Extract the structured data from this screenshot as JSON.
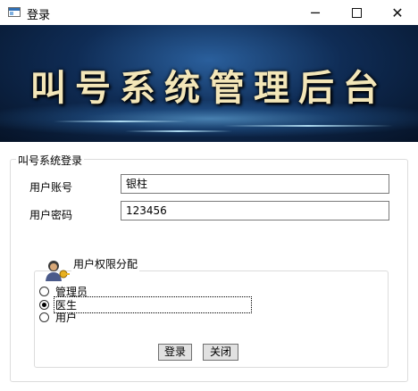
{
  "window": {
    "title": "登录",
    "minimize_glyph": "─",
    "close_glyph": "✕"
  },
  "banner": {
    "title": "叫号系统管理后台"
  },
  "login_group": {
    "legend": "叫号系统登录",
    "account_label": "用户账号",
    "account_value": "银柱",
    "password_label": "用户密码",
    "password_value": "123456"
  },
  "permission_group": {
    "legend": "用户权限分配",
    "icon": "user-key-icon",
    "options": [
      {
        "label": "管理员",
        "checked": false
      },
      {
        "label": "医生",
        "checked": true
      },
      {
        "label": "用户",
        "checked": false
      }
    ]
  },
  "buttons": {
    "login": "登录",
    "close": "关闭"
  }
}
